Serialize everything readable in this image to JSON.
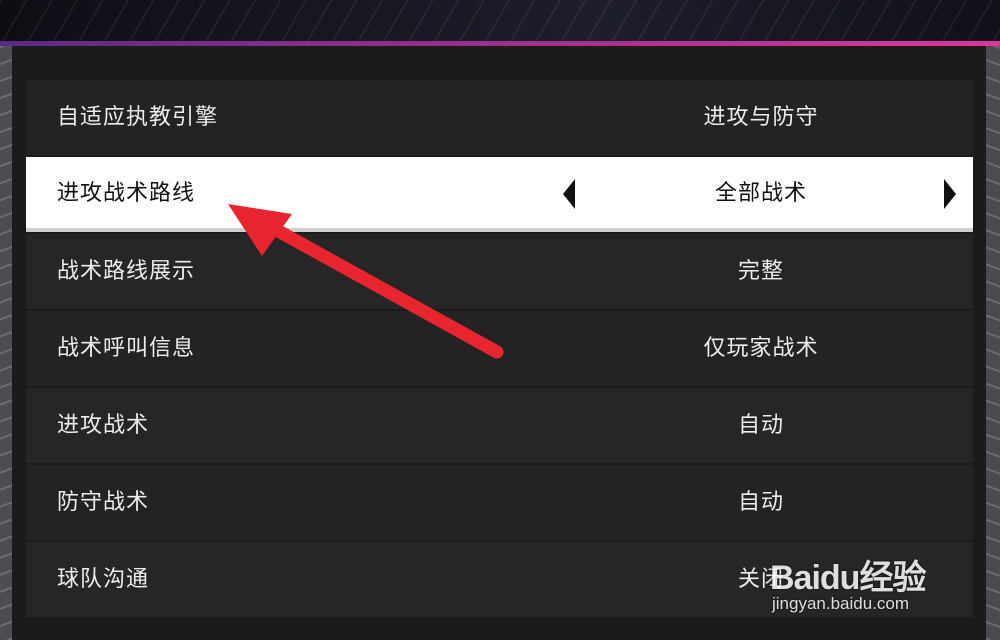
{
  "colors": {
    "accent_gradient_start": "#5b2a86",
    "accent_gradient_end": "#e0349a",
    "row_background": "#232323",
    "selected_row_background": "#ffffff",
    "annotation_arrow": "#e8242f"
  },
  "settings": {
    "rows": [
      {
        "label": "自适应执教引擎",
        "value": "进攻与防守"
      },
      {
        "label": "进攻战术路线",
        "value": "全部战术",
        "selected": true
      },
      {
        "label": "战术路线展示",
        "value": "完整"
      },
      {
        "label": "战术呼叫信息",
        "value": "仅玩家战术"
      },
      {
        "label": "进攻战术",
        "value": "自动"
      },
      {
        "label": "防守战术",
        "value": "自动"
      },
      {
        "label": "球队沟通",
        "value": "关闭"
      }
    ]
  },
  "annotation": {
    "type": "arrow",
    "icon": "red-arrow-icon"
  },
  "watermark": {
    "logo_text": "Baidu经验",
    "url": "jingyan.baidu.com"
  }
}
